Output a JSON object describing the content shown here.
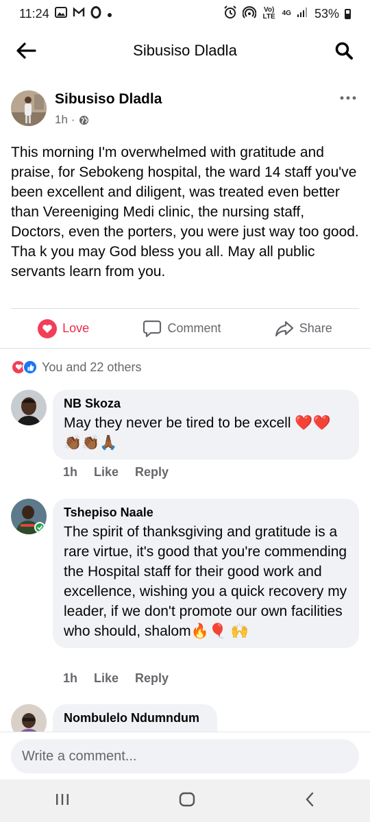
{
  "status_bar": {
    "time": "11:24",
    "battery": "53%",
    "network_label": "4G",
    "volte_label": "Vo) LTE"
  },
  "header": {
    "title": "Sibusiso Dladla"
  },
  "post": {
    "author": "Sibusiso Dladla",
    "time": "1h",
    "separator": "·",
    "privacy_icon": "globe-icon",
    "text_lines": [
      "This morning I'm overwhelmed with gratitude and praise, for Sebokeng hospital, the ward 14 staff you've been excellent and diligent, was treated even better than Vereeniging Medi clinic, the nursing staff, Doctors, even the porters, you were just way too good.",
      "Tha k you may God bless you all. May all public servants learn from you."
    ],
    "actions": {
      "love": "Love",
      "comment": "Comment",
      "share": "Share"
    },
    "reactions_summary": "You and 22 others"
  },
  "comments": [
    {
      "name": "NB Skoza",
      "text": "May they never be tired to be excell ❤️❤️👏🏾👏🏾🙏🏾",
      "time": "1h",
      "like": "Like",
      "reply": "Reply"
    },
    {
      "name": "Tshepiso Naale",
      "text": "The spirit of thanksgiving and gratitude is a rare virtue, it's good that you're commending the Hospital staff for their good work and excellence, wishing you a quick recovery my leader, if we don't promote our own facilities who should, shalom🔥🎈 🙌",
      "time": "1h",
      "like": "Like",
      "reply": "Reply"
    },
    {
      "name": "Nombulelo Ndumndum"
    }
  ],
  "composer": {
    "placeholder": "Write a comment..."
  },
  "colors": {
    "love_red": "#f33e58",
    "like_blue": "#1877f2",
    "bubble_gray": "#f0f2f5",
    "meta_gray": "#65676b"
  }
}
